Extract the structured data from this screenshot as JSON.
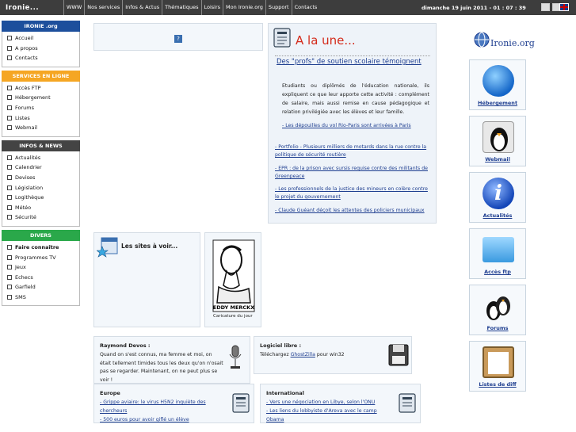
{
  "topbar": {
    "brand": "Ironie...",
    "nav": [
      "WWW",
      "Nos services",
      "Infos & Actus",
      "Thématiques",
      "Loisirs",
      "Mon Ironie.org",
      "Support",
      "Contacts"
    ],
    "datetime": "dimanche 19 juin 2011  -  01 : 07 : 39"
  },
  "sidebar": {
    "sec1": {
      "title": "IRONIE .org",
      "color": "#1d4f9c",
      "items": [
        "Accueil",
        "A propos",
        "Contacts"
      ]
    },
    "sec2": {
      "title": "SERVICES EN LIGNE",
      "color": "#f5a623",
      "items": [
        "Accès FTP",
        "Hébergement",
        "Forums",
        "Listes",
        "Webmail"
      ]
    },
    "sec3": {
      "title": "INFOS & NEWS",
      "color": "#444444",
      "items": [
        "Actualités",
        "Calendrier",
        "Devises",
        "Législation",
        "Logithèque",
        "Météo",
        "Sécurité"
      ]
    },
    "sec4": {
      "title": "DIVERS",
      "color": "#2aa84a",
      "items": [
        "Faire connaître",
        "Programmes TV",
        "Jeux",
        "Echecs",
        "Garfield",
        "SMS"
      ]
    }
  },
  "une": {
    "title": "A la une...",
    "feature_title": "Des \"profs\" de soutien scolaire témoignent",
    "feature_text": "Etudiants ou diplômés de l'éducation nationale, ils expliquent ce que leur apporte cette activité : complément de salaire, mais aussi remise en cause pédagogique et relation privilégiée avec les élèves et leur famille.",
    "feature_link": "- Les dépouilles du vol Rio-Paris sont arrivées à Paris",
    "news": [
      "- Portfolio - Plusieurs milliers de motards dans la rue contre la politique de sécurité routière",
      "- EPR : de la prison avec sursis requise contre des militants de Greenpeace",
      "- Les professionnels de la justice des mineurs en colère contre le projet du gouvernement",
      "- Claude Guéant déçoit les attentes des policiers municipaux"
    ]
  },
  "sites": {
    "title": "Les sites à voir..."
  },
  "caricature": {
    "name": "EDDY MERCKX",
    "caption": "Caricature du jour"
  },
  "logo": {
    "text": "Ironie.org"
  },
  "services": [
    {
      "label": "Hébergement",
      "icon": "globe-icon"
    },
    {
      "label": "Webmail",
      "icon": "penguin-mail-icon"
    },
    {
      "label": "Actualités",
      "icon": "info-icon"
    },
    {
      "label": "Accès ftp",
      "icon": "folder-icon"
    },
    {
      "label": "Forums",
      "icon": "penguins-icon"
    },
    {
      "label": "Listes de diff",
      "icon": "clipboard-icon"
    }
  ],
  "quote": {
    "title": "Raymond Devos :",
    "text": [
      "Quand on s'est connus, ma femme et moi, on",
      "était tellement timides tous les deux qu'on n'osait",
      "pas se regarder. Maintenant, on ne peut plus se",
      "voir !"
    ]
  },
  "software": {
    "title": "Logiciel libre :",
    "prefix": "Téléchargez ",
    "link": "GhostZilla",
    "suffix": " pour win32"
  },
  "europe": {
    "title": "Europe",
    "items": [
      "- Grippe aviaire: le virus H5N2 inquiète des chercheurs",
      "- 500 euros pour avoir giflé un élève"
    ]
  },
  "international": {
    "title": "International",
    "items": [
      "- Vers une négociation en Libye, selon l'ONU",
      "- Les liens du lobbyiste d'Areva avec le camp Obama"
    ]
  }
}
